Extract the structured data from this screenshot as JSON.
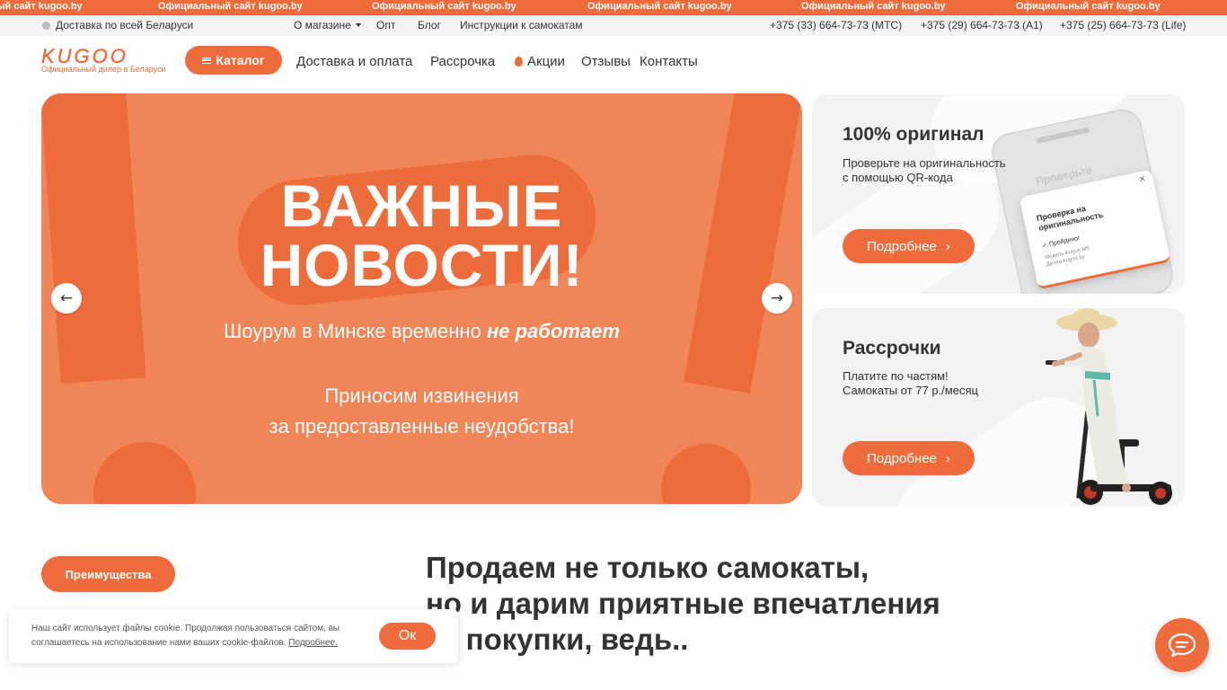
{
  "marquee": {
    "text": "Официальный сайт kugoo.by",
    "cropped_text": "ый сайт kugoo.by"
  },
  "topbar": {
    "delivery": "Доставка по всей Беларуси",
    "about": "О магазине",
    "wholesale": "Опт",
    "blog": "Блог",
    "instructions": "Инструкции к самокатам",
    "phones": [
      "+375 (33) 664-73-73 (МТС)",
      "+375 (29) 664-73-73 (А1)",
      "+375 (25) 664-73-73 (Life)"
    ]
  },
  "logo": {
    "word": "KUGOO",
    "subtitle": "Официальный дилер в Беларуси"
  },
  "header": {
    "catalog_label": "Каталог",
    "nav": [
      "Доставка и оплата",
      "Рассрочка",
      "Акции",
      "Отзывы",
      "Контакты"
    ]
  },
  "hero": {
    "title_line1": "ВАЖНЫЕ",
    "title_line2": "НОВОСТИ!",
    "subtitle_prefix": "Шоурум в Минске временно",
    "subtitle_emph": "не работает",
    "apology_line1": "Приносим извинения",
    "apology_line2": "за предоставленные неудобства!",
    "prev_arrow": "←",
    "next_arrow": "→"
  },
  "cards": [
    {
      "title": "100% оригинал",
      "text_line1": "Проверьте на оригинальность",
      "text_line2": "с помощью QR-кода",
      "button": "Подробнее",
      "button_arrow": "›",
      "phone_ghost": "Проверьте",
      "popup_title": "Проверка на оригинальность",
      "popup_pass": "✓ Пройдено!",
      "popup_meta_line1": "Модель Kugoo M5",
      "popup_meta_line2": "Дилер kugoo.by",
      "popup_close": "×"
    },
    {
      "title": "Рассрочки",
      "text_line1": "Платите по частям!",
      "text_line2": "Самокаты от 77 р./месяц",
      "button": "Подробнее",
      "button_arrow": "›"
    }
  ],
  "section": {
    "advantages_button": "Преимущества",
    "headline_line1": "Продаем не только самокаты,",
    "headline_line2": "но и дарим приятные впечатления",
    "headline_line3": "от покупки, ведь.."
  },
  "cookie": {
    "text": "Наш сайт использует файлы cookie. Продолжая пользоваться сайтом, вы соглашаетесь на использование нами ваших cookie-файлов.",
    "link": "Подробнее.",
    "ok": "Ок"
  },
  "colors": {
    "accent": "#ee6b3b",
    "hero_bg": "#f08558",
    "card_bg": "#f3f3f3"
  },
  "icons": {
    "catalog": "menu-icon",
    "promo": "fire-icon",
    "chat": "chat-bubble-icon",
    "prev": "arrow-left-icon",
    "next": "arrow-right-icon"
  }
}
